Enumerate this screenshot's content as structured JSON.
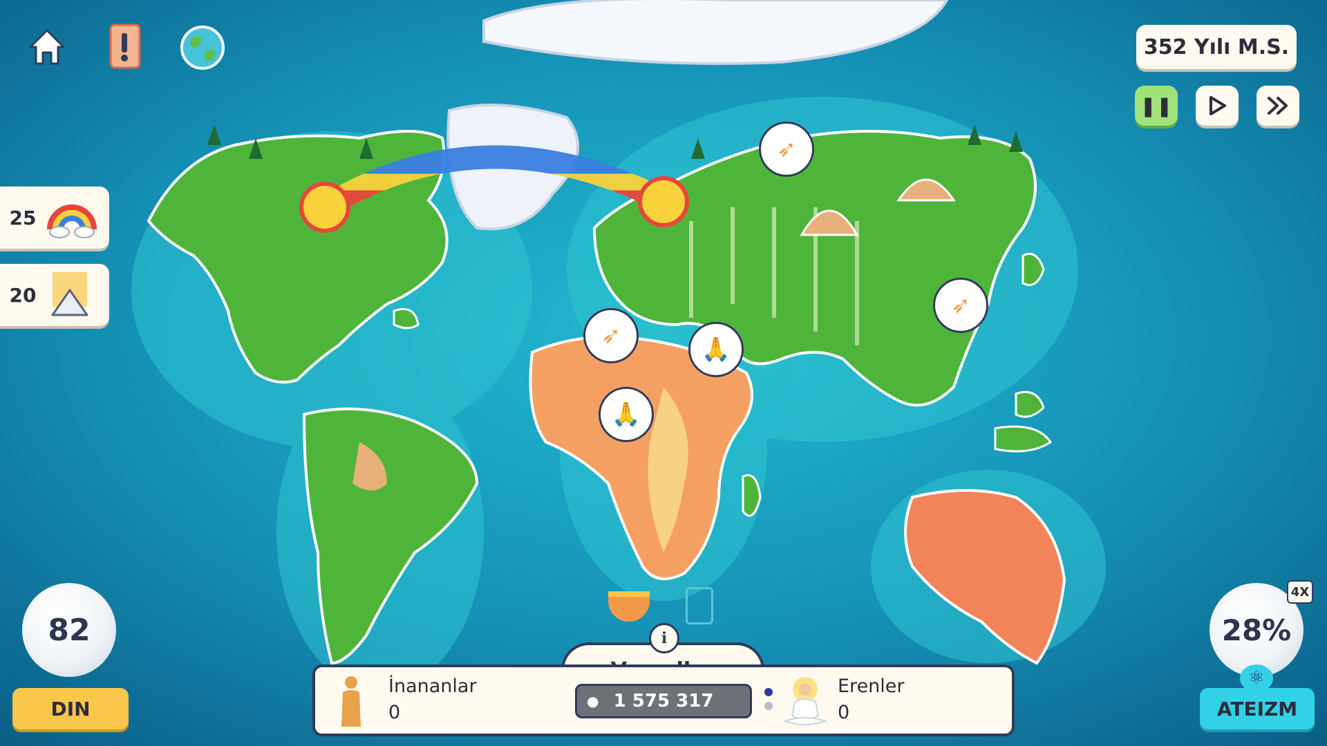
{
  "date": "352 Yılı M.S.",
  "speed_controls": [
    "pause",
    "play",
    "fast-forward"
  ],
  "speed_active": "pause",
  "powers": [
    {
      "count": "25",
      "icon": "rainbow-icon"
    },
    {
      "count": "20",
      "icon": "divine-light-pyramid-icon"
    }
  ],
  "faith": {
    "value": "82",
    "label": "DIN"
  },
  "atheism": {
    "value": "28%",
    "label": "ATEIZM",
    "badge": "4X"
  },
  "region": {
    "name": "Venedler",
    "population": "1 575 317",
    "believers_label": "İnananlar",
    "believers_value": "0",
    "saints_label": "Erenler",
    "saints_value": "0"
  },
  "map_markers": [
    "wing-flight-icon",
    "wing-flight-icon",
    "wing-flight-icon",
    "praying-hands-icon",
    "praying-hands-icon"
  ],
  "colors": {
    "ocean": "#0f7fa6",
    "land": "#4fb53a",
    "converted_land": "#f4a063",
    "panel_border": "#2f3b5b",
    "accent_green": "#9fe27a",
    "accent_gold": "#f7c64a",
    "accent_cyan": "#33d1e6"
  }
}
